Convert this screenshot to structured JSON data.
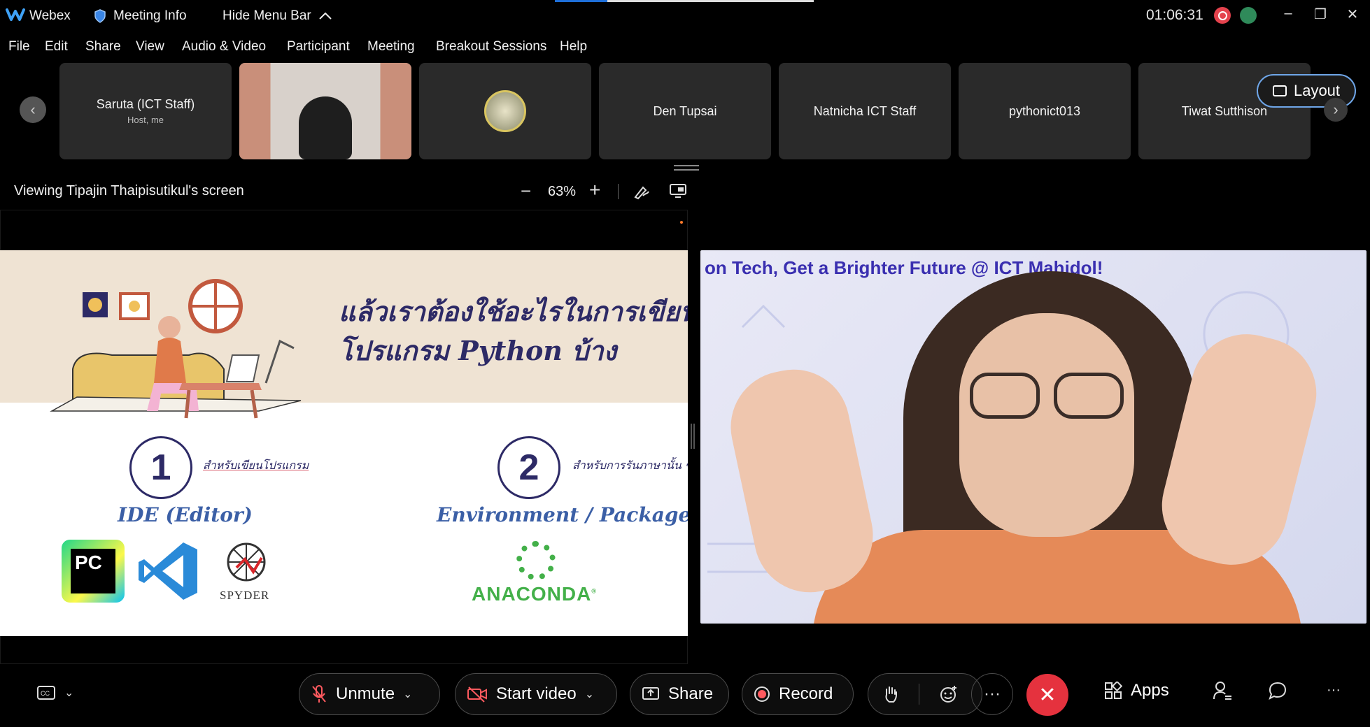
{
  "titlebar": {
    "app_name": "Webex",
    "meeting_info": "Meeting Info",
    "hide_menu_bar": "Hide Menu Bar",
    "timer": "01:06:31",
    "minimize": "–",
    "restore": "❐",
    "close": "✕"
  },
  "menu": [
    "File",
    "Edit",
    "Share",
    "View",
    "Audio & Video",
    "Participant",
    "Meeting",
    "Breakout Sessions",
    "Help"
  ],
  "participants": [
    {
      "name": "Saruta (ICT Staff)",
      "sub": "Host, me"
    },
    {
      "name": "",
      "sub": ""
    },
    {
      "name": "",
      "sub": ""
    },
    {
      "name": "Den Tupsai",
      "sub": ""
    },
    {
      "name": "Natnicha ICT Staff",
      "sub": ""
    },
    {
      "name": "pythonict013",
      "sub": ""
    },
    {
      "name": "Tiwat Sutthison",
      "sub": ""
    }
  ],
  "layout_button": "Layout",
  "share": {
    "viewing_label": "Viewing Tipajin Thaipisutikul's screen",
    "zoom_minus": "−",
    "zoom_value": "63%",
    "zoom_plus": "+"
  },
  "slide": {
    "title_line1": "แล้วเราต้องใช้อะไรในการเขียน",
    "title_line2": "โปรแกรม Python บ้าง",
    "item1_number": "1",
    "item1_caption": "สำหรับเขียนโปรแกรม",
    "item1_heading": "IDE (Editor)",
    "item2_number": "2",
    "item2_caption": "สำหรับการรันภาษานั้น ๆ",
    "item2_heading": "Environment / Package",
    "logo_pycharm": "PC",
    "logo_spyder": "SPYDER",
    "logo_anaconda": "ANACONDA"
  },
  "speaker": {
    "banner": "on Tech, Get a Brighter Future @ ICT Mahidol!"
  },
  "controls": {
    "unmute": "Unmute",
    "start_video": "Start video",
    "share": "Share",
    "record": "Record",
    "more": "···",
    "apps": "Apps",
    "overflow": "···"
  },
  "colors": {
    "accent_blue": "#6fa6e8",
    "end_red": "#e5323e",
    "record_red": "#e4424d",
    "slide_navy": "#2d2a66",
    "slide_blue": "#3b5fa6",
    "anaconda_green": "#43b049"
  }
}
